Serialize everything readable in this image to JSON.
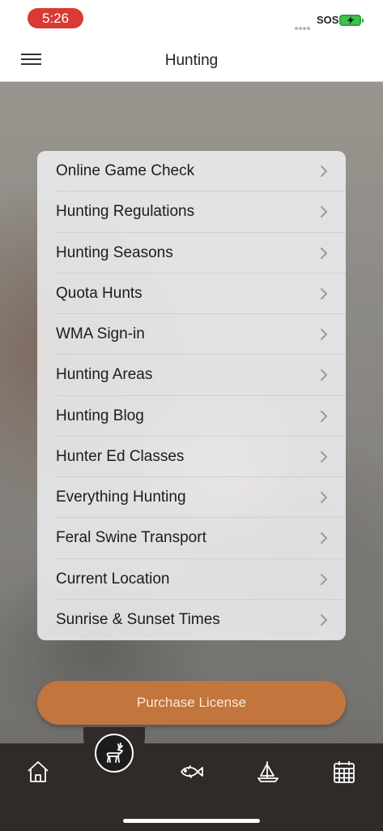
{
  "status_bar": {
    "time": "5:26",
    "carrier": "SOS"
  },
  "header": {
    "title": "Hunting",
    "menu_icon": "hamburger-menu-icon"
  },
  "menu": {
    "items": [
      {
        "label": "Online Game Check"
      },
      {
        "label": "Hunting Regulations"
      },
      {
        "label": "Hunting Seasons"
      },
      {
        "label": "Quota Hunts"
      },
      {
        "label": "WMA Sign-in"
      },
      {
        "label": "Hunting Areas"
      },
      {
        "label": "Hunting Blog"
      },
      {
        "label": "Hunter Ed Classes"
      },
      {
        "label": "Everything Hunting"
      },
      {
        "label": "Feral Swine Transport"
      },
      {
        "label": "Current Location"
      },
      {
        "label": "Sunrise & Sunset Times"
      }
    ]
  },
  "purchase_button": {
    "label": "Purchase License",
    "color": "#c2753c"
  },
  "tab_bar": {
    "tabs": [
      {
        "icon": "home-icon",
        "active": false
      },
      {
        "icon": "deer-icon",
        "active": true
      },
      {
        "icon": "fish-icon",
        "active": false
      },
      {
        "icon": "sailboat-icon",
        "active": false
      },
      {
        "icon": "calendar-icon",
        "active": false
      }
    ]
  },
  "colors": {
    "accent": "#c2753c",
    "time_pill": "#d93a34",
    "tab_bar": "#2e2b28"
  }
}
